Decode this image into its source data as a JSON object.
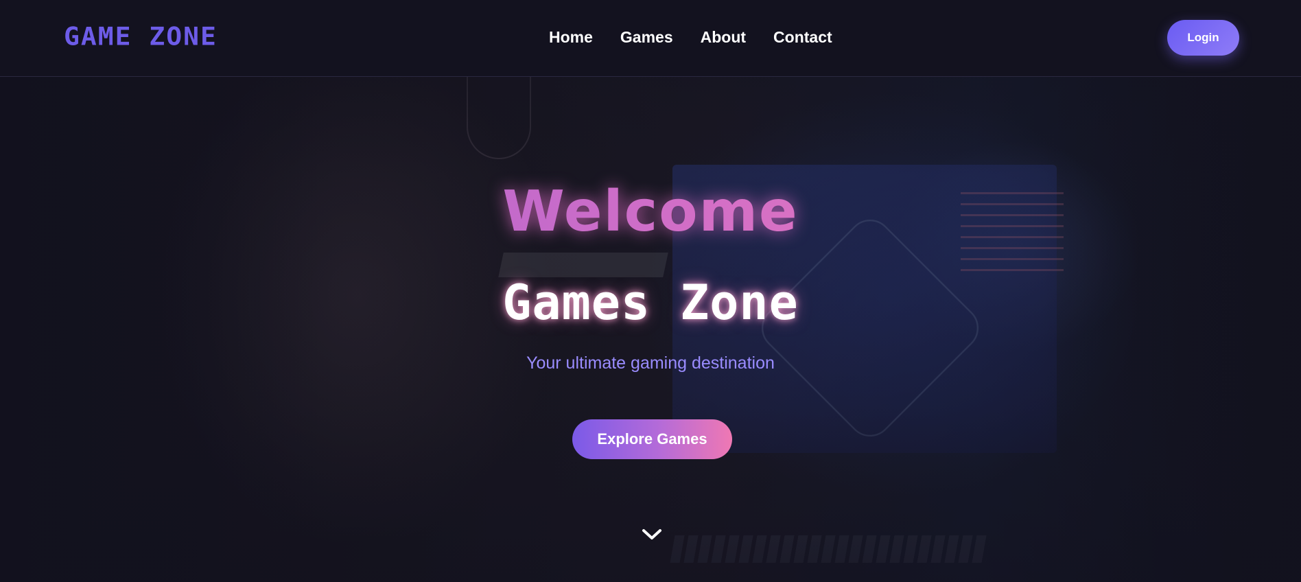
{
  "nav": {
    "logo": "GAME ZONE",
    "links": [
      "Home",
      "Games",
      "About",
      "Contact"
    ],
    "login_label": "Login"
  },
  "hero": {
    "welcome": "Welcome",
    "title": "Games Zone",
    "tagline": "Your ultimate gaming destination",
    "cta_label": "Explore Games",
    "scroll_icon": "chevron-down-icon"
  },
  "colors": {
    "background": "#13121f",
    "logo": "#6d5ce8",
    "accent_purple": "#7b5ae8",
    "accent_pink": "#ef78b3",
    "tagline": "#9a8cff"
  }
}
